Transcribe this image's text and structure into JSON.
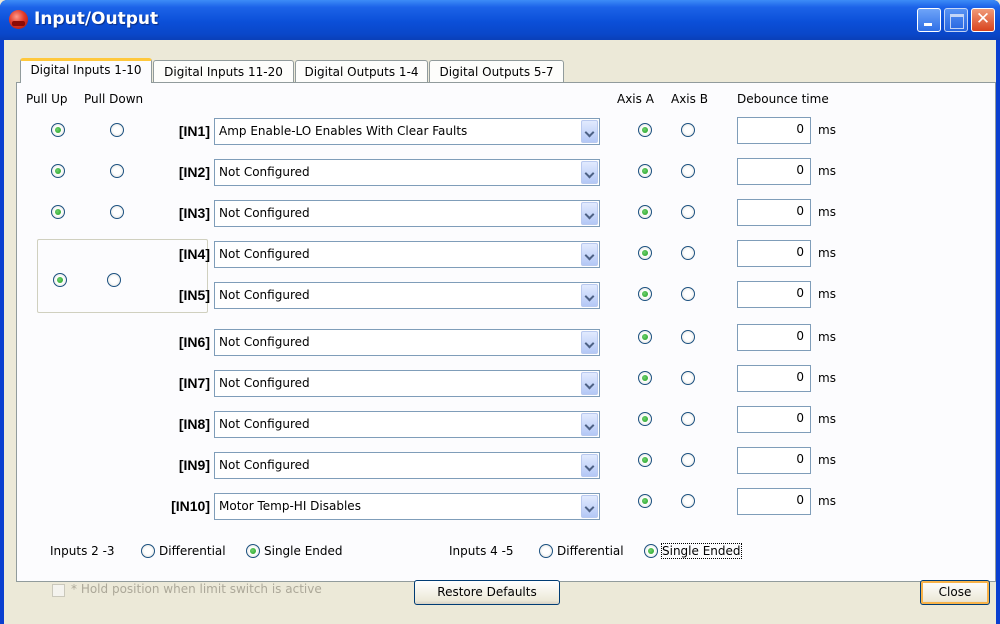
{
  "window": {
    "title": "Input/Output"
  },
  "tabs": [
    "Digital Inputs 1-10",
    "Digital Inputs 11-20",
    "Digital Outputs 1-4",
    "Digital Outputs 5-7"
  ],
  "headers": {
    "pull_up": "Pull Up",
    "pull_down": "Pull Down",
    "axis_a": "Axis A",
    "axis_b": "Axis B",
    "debounce": "Debounce time"
  },
  "inputs": [
    {
      "label": "[IN1]",
      "function": "Amp Enable-LO Enables With Clear Faults",
      "axis": "A",
      "debounce": "0",
      "unit": "ms"
    },
    {
      "label": "[IN2]",
      "function": "Not Configured",
      "axis": "A",
      "debounce": "0",
      "unit": "ms"
    },
    {
      "label": "[IN3]",
      "function": "Not Configured",
      "axis": "A",
      "debounce": "0",
      "unit": "ms"
    },
    {
      "label": "[IN4]",
      "function": "Not Configured",
      "axis": "A",
      "debounce": "0",
      "unit": "ms"
    },
    {
      "label": "[IN5]",
      "function": "Not Configured",
      "axis": "A",
      "debounce": "0",
      "unit": "ms"
    },
    {
      "label": "[IN6]",
      "function": "Not Configured",
      "axis": "A",
      "debounce": "0",
      "unit": "ms"
    },
    {
      "label": "[IN7]",
      "function": "Not Configured",
      "axis": "A",
      "debounce": "0",
      "unit": "ms"
    },
    {
      "label": "[IN8]",
      "function": "Not Configured",
      "axis": "A",
      "debounce": "0",
      "unit": "ms"
    },
    {
      "label": "[IN9]",
      "function": "Not Configured",
      "axis": "A",
      "debounce": "0",
      "unit": "ms"
    },
    {
      "label": "[IN10]",
      "function": "Motor Temp-HI Disables",
      "axis": "A",
      "debounce": "0",
      "unit": "ms"
    }
  ],
  "input_mode": {
    "group_23_label": "Inputs 2 -3",
    "group_45_label": "Inputs 4 -5",
    "differential": "Differential",
    "single_ended": "Single Ended",
    "group_23_selected": "Single Ended",
    "group_45_selected": "Single Ended"
  },
  "footer": {
    "hold_position": "* Hold position when limit switch is active",
    "restore_defaults": "Restore Defaults",
    "close": "Close"
  }
}
